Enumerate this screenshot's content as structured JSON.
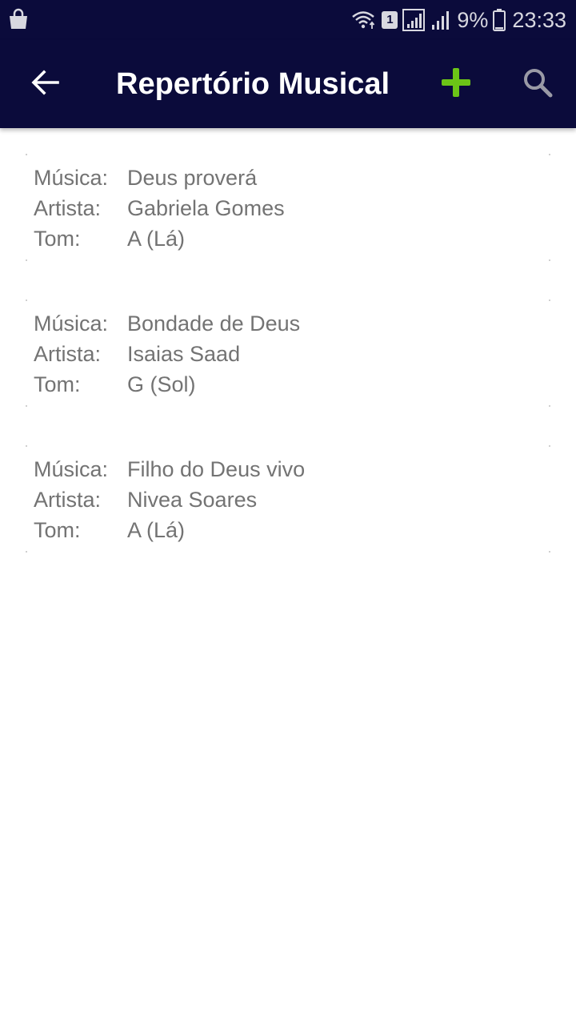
{
  "status_bar": {
    "battery_text": "9%",
    "time": "23:33",
    "sim_label": "1",
    "icons": [
      "shopping-bag-icon",
      "wifi-icon",
      "sim-1-badge",
      "signal-icon",
      "signal-icon-2",
      "battery-icon"
    ]
  },
  "app_bar": {
    "title": "Repertório Musical",
    "back_icon": "arrow-left-icon",
    "add_icon": "plus-icon",
    "search_icon": "search-icon",
    "background_color": "#0b0b3b",
    "add_icon_color": "#6cc417"
  },
  "songs": [
    {
      "music_label": "Música:",
      "music": "Deus proverá",
      "artist_label": "Artista:",
      "artist": "Gabriela Gomes",
      "key_label": "Tom:",
      "key": "A (Lá)"
    },
    {
      "music_label": "Música:",
      "music": "Bondade de Deus",
      "artist_label": "Artista:",
      "artist": "Isaias Saad",
      "key_label": "Tom:",
      "key": "G (Sol)"
    },
    {
      "music_label": "Música:",
      "music": "Filho do Deus vivo",
      "artist_label": "Artista:",
      "artist": "Nivea Soares",
      "key_label": "Tom:",
      "key": "A (Lá)"
    }
  ]
}
